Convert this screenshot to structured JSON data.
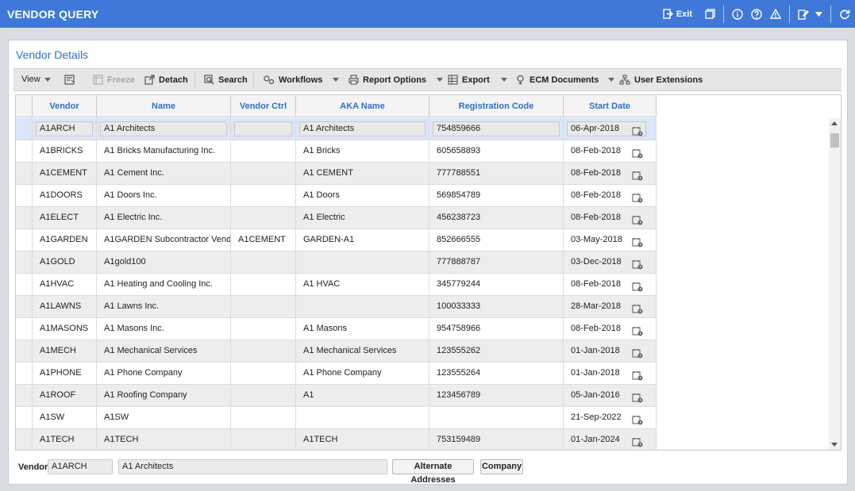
{
  "window": {
    "title": "VENDOR QUERY",
    "exit_label": "Exit"
  },
  "panel": {
    "title": "Vendor Details"
  },
  "toolbar": {
    "view": "View",
    "freeze": "Freeze",
    "detach": "Detach",
    "search": "Search",
    "workflows": "Workflows",
    "report_options": "Report Options",
    "export": "Export",
    "ecm_documents": "ECM Documents",
    "user_extensions": "User Extensions"
  },
  "grid": {
    "columns": [
      "Vendor",
      "Name",
      "Vendor Ctrl",
      "AKA Name",
      "Registration Code",
      "Start Date"
    ],
    "rows": [
      {
        "vendor": "A1ARCH",
        "name": "A1 Architects",
        "ctrl": "",
        "aka": "A1 Architects",
        "reg": "754859666",
        "start": "06-Apr-2018"
      },
      {
        "vendor": "A1BRICKS",
        "name": "A1 Bricks Manufacturing Inc.",
        "ctrl": "",
        "aka": "A1 Bricks",
        "reg": "605658893",
        "start": "08-Feb-2018"
      },
      {
        "vendor": "A1CEMENT",
        "name": "A1 Cement Inc.",
        "ctrl": "",
        "aka": "A1 CEMENT",
        "reg": "777788551",
        "start": "08-Feb-2018"
      },
      {
        "vendor": "A1DOORS",
        "name": "A1 Doors Inc.",
        "ctrl": "",
        "aka": "A1 Doors",
        "reg": "569854789",
        "start": "08-Feb-2018"
      },
      {
        "vendor": "A1ELECT",
        "name": "A1 Electric Inc.",
        "ctrl": "",
        "aka": "A1 Electric",
        "reg": "456238723",
        "start": "08-Feb-2018"
      },
      {
        "vendor": "A1GARDEN",
        "name": "A1GARDEN Subcontractor Vend",
        "ctrl": "A1CEMENT",
        "aka": "GARDEN-A1",
        "reg": "852666555",
        "start": "03-May-2018"
      },
      {
        "vendor": "A1GOLD",
        "name": "A1gold100",
        "ctrl": "",
        "aka": "",
        "reg": "777888787",
        "start": "03-Dec-2018"
      },
      {
        "vendor": "A1HVAC",
        "name": "A1 Heating and Cooling Inc.",
        "ctrl": "",
        "aka": "A1 HVAC",
        "reg": "345779244",
        "start": "08-Feb-2018"
      },
      {
        "vendor": "A1LAWNS",
        "name": "A1 Lawns Inc.",
        "ctrl": "",
        "aka": "",
        "reg": "100033333",
        "start": "28-Mar-2018"
      },
      {
        "vendor": "A1MASONS",
        "name": "A1 Masons Inc.",
        "ctrl": "",
        "aka": "A1 Masons",
        "reg": "954758966",
        "start": "08-Feb-2018"
      },
      {
        "vendor": "A1MECH",
        "name": "A1 Mechanical Services",
        "ctrl": "",
        "aka": "A1 Mechanical Services",
        "reg": "123555262",
        "start": "01-Jan-2018"
      },
      {
        "vendor": "A1PHONE",
        "name": "A1 Phone Company",
        "ctrl": "",
        "aka": "A1 Phone Company",
        "reg": "123555264",
        "start": "01-Jan-2018"
      },
      {
        "vendor": "A1ROOF",
        "name": "A1 Roofing Company",
        "ctrl": "",
        "aka": "A1",
        "reg": "123456789",
        "start": "05-Jan-2016"
      },
      {
        "vendor": "A1SW",
        "name": "A1SW",
        "ctrl": "",
        "aka": "",
        "reg": "",
        "start": "21-Sep-2022"
      },
      {
        "vendor": "A1TECH",
        "name": "A1TECH",
        "ctrl": "",
        "aka": "A1TECH",
        "reg": "753159489",
        "start": "01-Jan-2024"
      }
    ]
  },
  "footer": {
    "vendor_label": "Vendor",
    "vendor_code": "A1ARCH",
    "vendor_name": "A1 Architects",
    "alternate_addresses": "Alternate Addresses",
    "company": "Company"
  },
  "colors": {
    "titlebar": "#3f78d8",
    "accent": "#2f6fc9"
  }
}
